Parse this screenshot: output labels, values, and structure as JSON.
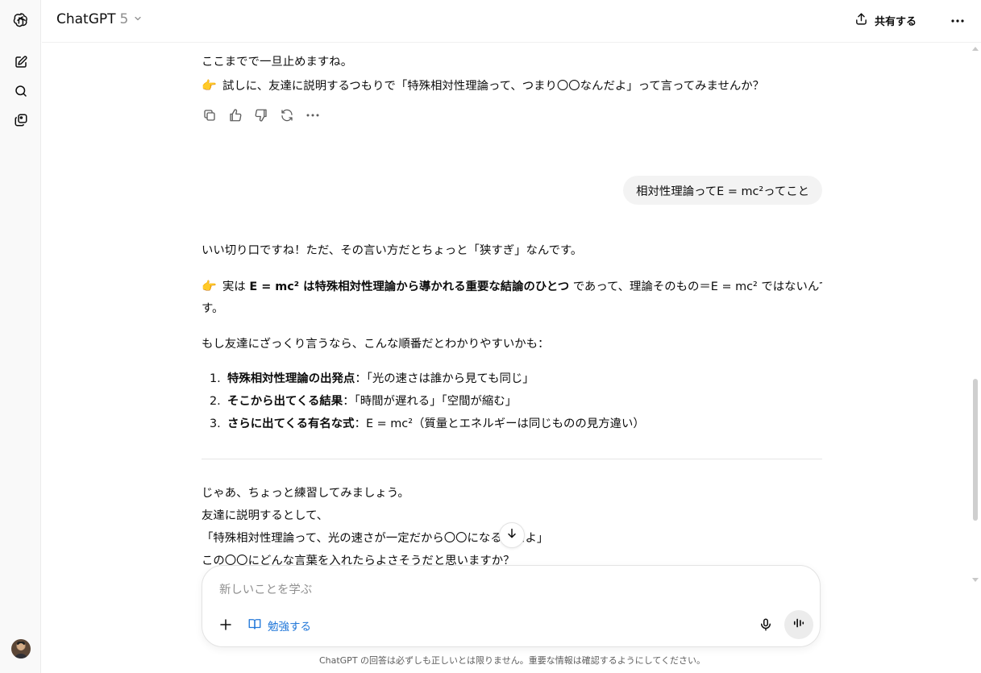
{
  "header": {
    "model_name": "ChatGPT",
    "model_version": "5",
    "share_label": "共有する"
  },
  "assistant_prev": {
    "line1": "ここまでで一旦止めますね。",
    "line2_emoji": "👉",
    "line2": "試しに、友達に説明するつもりで「特殊相対性理論って、つまり〇〇なんだよ」って言ってみませんか？"
  },
  "user_message": "相対性理論ってE = mc²ってこと",
  "assistant": {
    "intro": "いい切り口ですね！ただ、その言い方だとちょっと「狭すぎ」なんです。",
    "point_emoji": "👉",
    "point_pre": "実は",
    "point_bold": "E = mc² は特殊相対性理論から導かれる重要な結論のひとつ",
    "point_post": "であって、理論そのもの＝E = mc² ではないんで",
    "point_wrap": "す。",
    "lead": "もし友達にざっくり言うなら、こんな順番だとわかりやすいかも：",
    "list": [
      {
        "num": "1.",
        "bold": "特殊相対性理論の出発点",
        "text": "：「光の速さは誰から見ても同じ」"
      },
      {
        "num": "2.",
        "bold": "そこから出てくる結果",
        "text": "：「時間が遅れる」「空間が縮む」"
      },
      {
        "num": "3.",
        "bold": "さらに出てくる有名な式",
        "text": "：E = mc²（質量とエネルギーは同じものの見方違い）"
      }
    ],
    "practice_1": "じゃあ、ちょっと練習してみましょう。",
    "practice_2": "友達に説明するとして、",
    "practice_3": "「特殊相対性理論って、光の速さが一定だから〇〇になるんだよ」",
    "practice_4": "この〇〇にどんな言葉を入れたらよさそうだと思いますか？"
  },
  "composer": {
    "placeholder": "新しいことを学ぶ",
    "study_label": "勉強する"
  },
  "disclaimer": "ChatGPT の回答は必ずしも正しいとは限りません。重要な情報は確認するようにしてください。",
  "colors": {
    "accent_blue": "#2378d9",
    "user_bubble": "#f3f3f3",
    "sidebar_bg": "#f9f9f9"
  }
}
